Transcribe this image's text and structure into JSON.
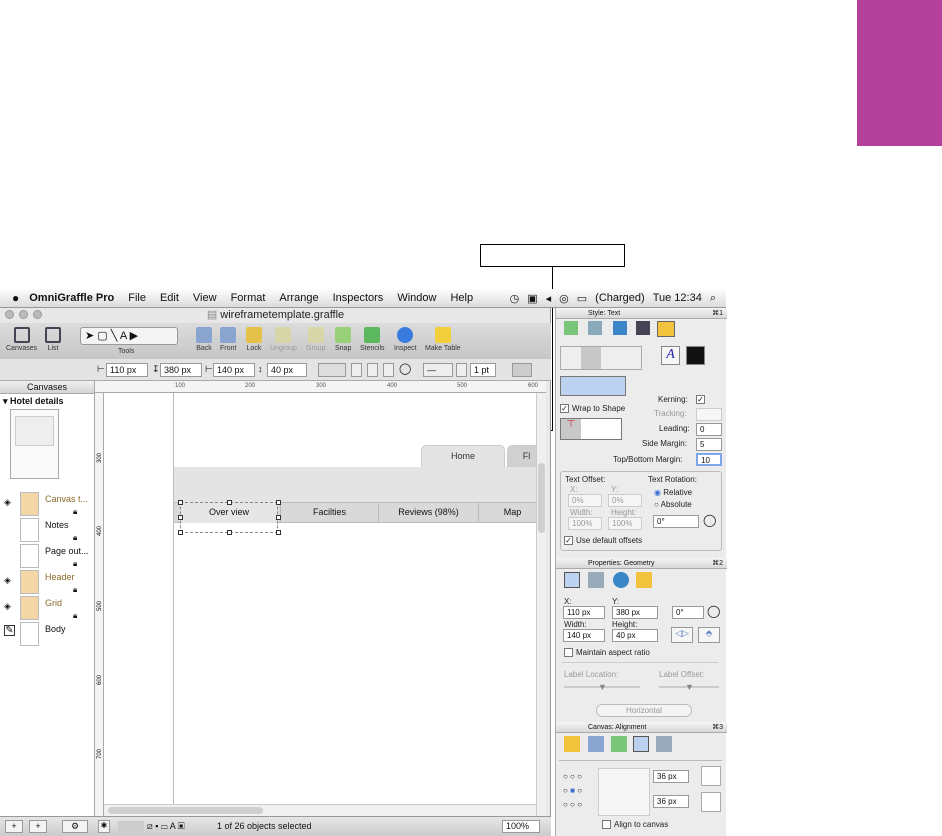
{
  "menubar": {
    "app": "OmniGraffle Pro",
    "items": [
      "File",
      "Edit",
      "View",
      "Format",
      "Arrange",
      "Inspectors",
      "Window",
      "Help"
    ],
    "battery": "(Charged)",
    "clock": "Tue 12:34"
  },
  "window": {
    "title": "wireframetemplate.graffle"
  },
  "toolbar": {
    "canvases": "Canvases",
    "list": "List",
    "tools": "Tools",
    "back": "Back",
    "front": "Front",
    "lock": "Lock",
    "ungroup": "Ungroup",
    "group": "Group",
    "snap": "Snap",
    "stencils": "Stencils",
    "inspect": "Inspect",
    "make_table": "Make Table"
  },
  "format": {
    "x": "110 px",
    "y": "380 px",
    "width": "140 px",
    "height": "40 px",
    "stroke": "1 pt"
  },
  "ruler": {
    "ticks": [
      "100",
      "200",
      "300",
      "400",
      "500",
      "600"
    ],
    "vticks": [
      "300",
      "400",
      "500",
      "600",
      "700"
    ]
  },
  "sidebar": {
    "header": "Canvases",
    "canvas_name": "Hotel details",
    "layers": [
      {
        "name": "Canvas t...",
        "color": "#f3d7a6",
        "text_color": "#8a6a2a"
      },
      {
        "name": "Notes",
        "color": "#ffffff",
        "text_color": "#111111"
      },
      {
        "name": "Page out...",
        "color": "#ffffff",
        "text_color": "#111111"
      },
      {
        "name": "Header",
        "color": "#f3d7a6",
        "text_color": "#8a6a2a"
      },
      {
        "name": "Grid",
        "color": "#f3d7a6",
        "text_color": "#8a6a2a"
      },
      {
        "name": "Body",
        "color": "#ffffff",
        "text_color": "#111111"
      }
    ]
  },
  "canvas": {
    "tabs": [
      "Home",
      "Fl"
    ],
    "nav": [
      "Over view",
      "Facilties",
      "Reviews (98%)",
      "Map"
    ]
  },
  "status": {
    "selection": "1 of 26 objects selected",
    "zoom": "100%"
  },
  "inspector": {
    "style_title": "Style: Text",
    "style_key": "⌘1",
    "kerning": "Kerning:",
    "tracking": "Tracking:",
    "leading": "Leading:",
    "leading_val": "0",
    "side_margin": "Side Margin:",
    "side_val": "5",
    "tb_margin": "Top/Bottom Margin:",
    "tb_val": "10",
    "wrap": "Wrap to Shape",
    "text_offset": "Text Offset:",
    "text_rotation": "Text Rotation:",
    "x": "X:",
    "y": "Y:",
    "x_val": "0%",
    "y_val": "0%",
    "width": "Width:",
    "height": "Height:",
    "w_val": "100%",
    "h_val": "100%",
    "relative": "Relative",
    "absolute": "Absolute",
    "rot_val": "0°",
    "use_default": "Use default offsets",
    "geom_title": "Properties: Geometry",
    "geom_key": "⌘2",
    "gx": "X:",
    "gy": "Y:",
    "gx_val": "110 px",
    "gy_val": "380 px",
    "grot": "0°",
    "gwidth": "Width:",
    "gheight": "Height:",
    "gw_val": "140 px",
    "gh_val": "40 px",
    "aspect": "Maintain aspect ratio",
    "label_location": "Label Location:",
    "label_offset": "Label Offset:",
    "horizontal": "Horizontal",
    "align_title": "Canvas: Alignment",
    "align_key": "⌘3",
    "a1": "36 px",
    "a2": "36 px",
    "align_canvas": "Align to canvas"
  },
  "colors": {
    "accent_tab": "#b5429a",
    "select_blue": "#3d78d8"
  }
}
